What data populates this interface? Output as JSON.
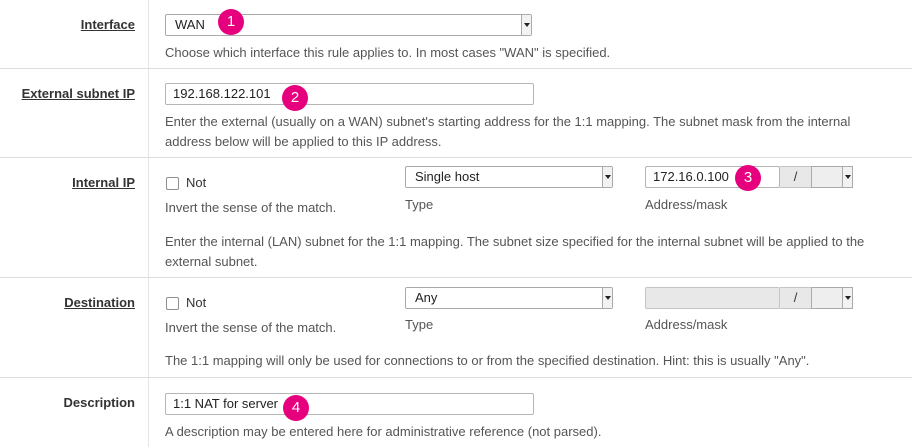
{
  "interface": {
    "label": "Interface",
    "value": "WAN",
    "help": "Choose which interface this rule applies to. In most cases \"WAN\" is specified.",
    "badge": "1"
  },
  "external_subnet": {
    "label": "External subnet IP",
    "value": "192.168.122.101",
    "help_line1": "Enter the external (usually on a WAN) subnet's starting address for the 1:1 mapping. The subnet mask from the internal",
    "help_line2": "address below will be applied to this IP address.",
    "badge": "2"
  },
  "internal_ip": {
    "label": "Internal IP",
    "not_label": "Not",
    "not_help": "Invert the sense of the match.",
    "type_value": "Single host",
    "type_label": "Type",
    "address_value": "172.16.0.100",
    "slash": "/",
    "mask_label": "Address/mask",
    "help_line1": "Enter the internal (LAN) subnet for the 1:1 mapping. The subnet size specified for the internal subnet will be applied to the",
    "help_line2": "external subnet.",
    "badge": "3"
  },
  "destination": {
    "label": "Destination",
    "not_label": "Not",
    "not_help": "Invert the sense of the match.",
    "type_value": "Any",
    "type_label": "Type",
    "address_value": "",
    "slash": "/",
    "mask_label": "Address/mask",
    "help": "The 1:1 mapping will only be used for connections to or from the specified destination. Hint: this is usually \"Any\"."
  },
  "description": {
    "label": "Description",
    "value": "1:1 NAT for server",
    "help": "A description may be entered here for administrative reference (not parsed).",
    "badge": "4"
  },
  "colors": {
    "badge": "#e6007e",
    "border": "#dddddd"
  }
}
